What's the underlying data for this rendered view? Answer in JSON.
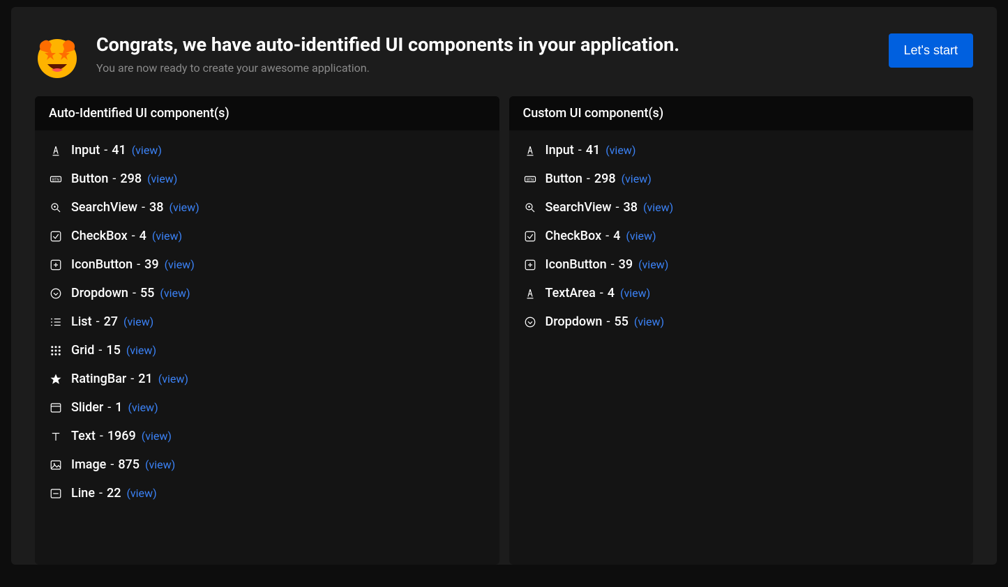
{
  "header": {
    "title": "Congrats, we have auto-identified UI components in your application.",
    "subtitle": "You are now ready to create your awesome application.",
    "button": "Let's start"
  },
  "panels": {
    "auto": {
      "title": "Auto-Identified UI component(s)",
      "items": [
        {
          "icon": "input",
          "name": "Input",
          "count": 41,
          "view": "(view)"
        },
        {
          "icon": "button",
          "name": "Button",
          "count": 298,
          "view": "(view)"
        },
        {
          "icon": "search",
          "name": "SearchView",
          "count": 38,
          "view": "(view)"
        },
        {
          "icon": "checkbox",
          "name": "CheckBox",
          "count": 4,
          "view": "(view)"
        },
        {
          "icon": "iconbutton",
          "name": "IconButton",
          "count": 39,
          "view": "(view)"
        },
        {
          "icon": "dropdown",
          "name": "Dropdown",
          "count": 55,
          "view": "(view)"
        },
        {
          "icon": "list",
          "name": "List",
          "count": 27,
          "view": "(view)"
        },
        {
          "icon": "grid",
          "name": "Grid",
          "count": 15,
          "view": "(view)"
        },
        {
          "icon": "rating",
          "name": "RatingBar",
          "count": 21,
          "view": "(view)"
        },
        {
          "icon": "slider",
          "name": "Slider",
          "count": 1,
          "view": "(view)"
        },
        {
          "icon": "text",
          "name": "Text",
          "count": 1969,
          "view": "(view)"
        },
        {
          "icon": "image",
          "name": "Image",
          "count": 875,
          "view": "(view)"
        },
        {
          "icon": "line",
          "name": "Line",
          "count": 22,
          "view": "(view)"
        }
      ]
    },
    "custom": {
      "title": "Custom UI component(s)",
      "items": [
        {
          "icon": "input",
          "name": "Input",
          "count": 41,
          "view": "(view)"
        },
        {
          "icon": "button",
          "name": "Button",
          "count": 298,
          "view": "(view)"
        },
        {
          "icon": "search",
          "name": "SearchView",
          "count": 38,
          "view": "(view)"
        },
        {
          "icon": "checkbox",
          "name": "CheckBox",
          "count": 4,
          "view": "(view)"
        },
        {
          "icon": "iconbutton",
          "name": "IconButton",
          "count": 39,
          "view": "(view)"
        },
        {
          "icon": "input",
          "name": "TextArea",
          "count": 4,
          "view": "(view)"
        },
        {
          "icon": "dropdown",
          "name": "Dropdown",
          "count": 55,
          "view": "(view)"
        }
      ]
    }
  },
  "separator": " - "
}
